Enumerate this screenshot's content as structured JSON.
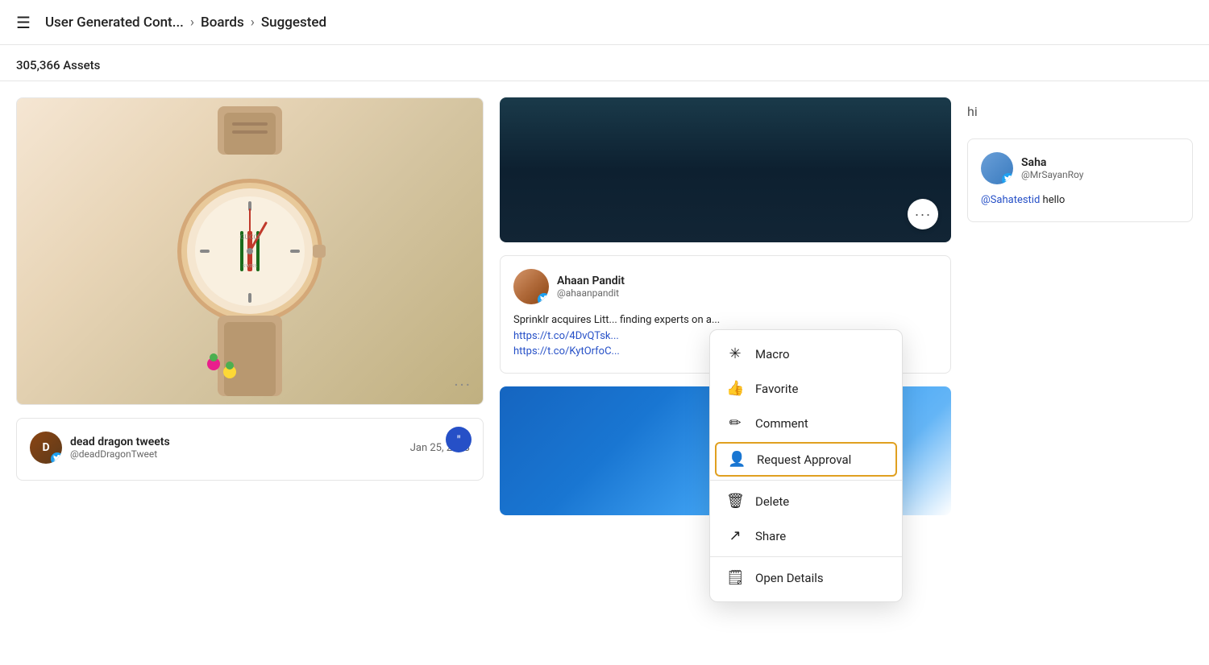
{
  "header": {
    "hamburger": "☰",
    "breadcrumb": {
      "part1": "User Generated Cont...",
      "sep1": "›",
      "part2": "Boards",
      "sep2": "›",
      "part3": "Suggested"
    }
  },
  "assets_bar": {
    "count": "305,366 Assets"
  },
  "cards": {
    "watch_dots": "···",
    "dragon": {
      "initials": "D",
      "name": "dead dragon tweets",
      "handle": "@deadDragonTweet",
      "date": "Jan 25, 2018"
    },
    "ahaan": {
      "name": "Ahaan Pandit",
      "handle": "@ahaanpandit",
      "tweet_text": "Sprinklr acquires Litt... finding experts on a...",
      "link1": "https://t.co/4DvQTsk...",
      "link2": "https://t.co/KytOrfoC..."
    },
    "hi_text": "hi",
    "saha": {
      "name": "Saha",
      "handle": "@MrSayanRoy",
      "mention": "@Sahatestid",
      "text": "hello"
    }
  },
  "more_button": {
    "label": "···"
  },
  "context_menu": {
    "items": [
      {
        "id": "macro",
        "icon": "✳",
        "label": "Macro",
        "highlighted": false
      },
      {
        "id": "favorite",
        "icon": "👍",
        "label": "Favorite",
        "highlighted": false
      },
      {
        "id": "comment",
        "icon": "✏",
        "label": "Comment",
        "highlighted": false
      },
      {
        "id": "request-approval",
        "icon": "👤",
        "label": "Request Approval",
        "highlighted": true
      },
      {
        "id": "delete",
        "icon": "🗑",
        "label": "Delete",
        "highlighted": false
      },
      {
        "id": "share",
        "icon": "↗",
        "label": "Share",
        "highlighted": false
      },
      {
        "id": "open-details",
        "icon": "🗒",
        "label": "Open Details",
        "highlighted": false
      }
    ]
  }
}
